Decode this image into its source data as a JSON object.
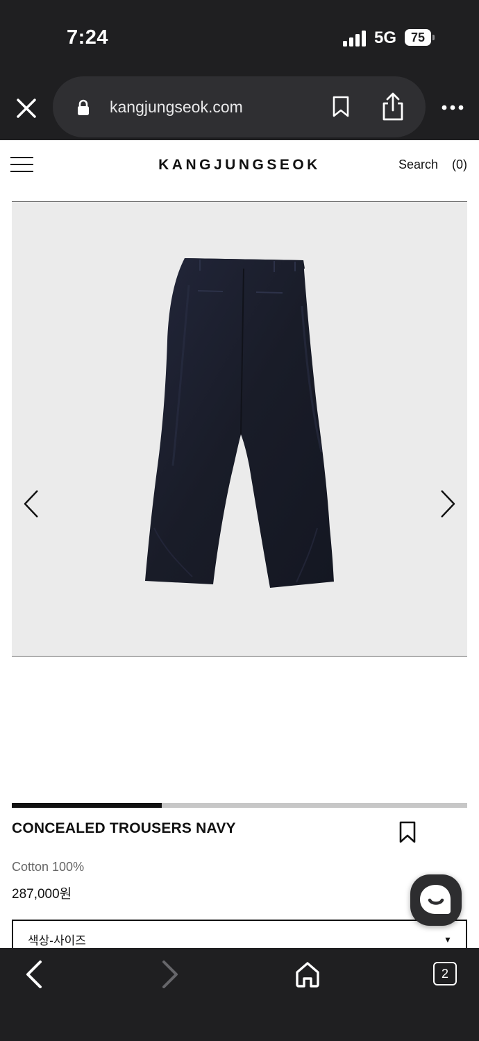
{
  "status_bar": {
    "time": "7:24",
    "network": "5G",
    "battery": "75",
    "signal_icon": "cellular-signal-icon",
    "battery_icon": "battery-icon"
  },
  "browser": {
    "url": "kangjungseok.com",
    "icons": {
      "close": "close-icon",
      "lock": "lock-icon",
      "bookmark": "bookmark-icon",
      "share": "share-icon",
      "more": "ellipsis-icon",
      "back": "chevron-left-icon",
      "forward": "chevron-right-icon",
      "home": "home-icon"
    },
    "tab_count": "2",
    "forward_disabled": true
  },
  "site_header": {
    "logo": "KANGJUNGSEOK",
    "search_label": "Search",
    "cart_label": "(0)",
    "menu_icon": "hamburger-menu-icon"
  },
  "gallery": {
    "image_description_icon": "navy-trousers-product-photo",
    "prev_icon": "chevron-left-icon",
    "next_icon": "chevron-right-icon",
    "progress_fraction": 0.33
  },
  "product": {
    "name": "CONCEALED TROUSERS NAVY",
    "material": "Cotton 100%",
    "price": "287,000원",
    "option_placeholder": "색상-사이즈",
    "wishlist_icon": "bookmark-icon"
  },
  "chat": {
    "icon": "chat-smile-icon"
  },
  "colors": {
    "chrome_bg": "#1f1f21",
    "url_bar_bg": "#2f2f32",
    "image_bg": "#ebebeb",
    "trousers": "#1b1e29",
    "text": "#111111",
    "muted_text": "#666666",
    "progress_track": "#c7c7c7"
  }
}
